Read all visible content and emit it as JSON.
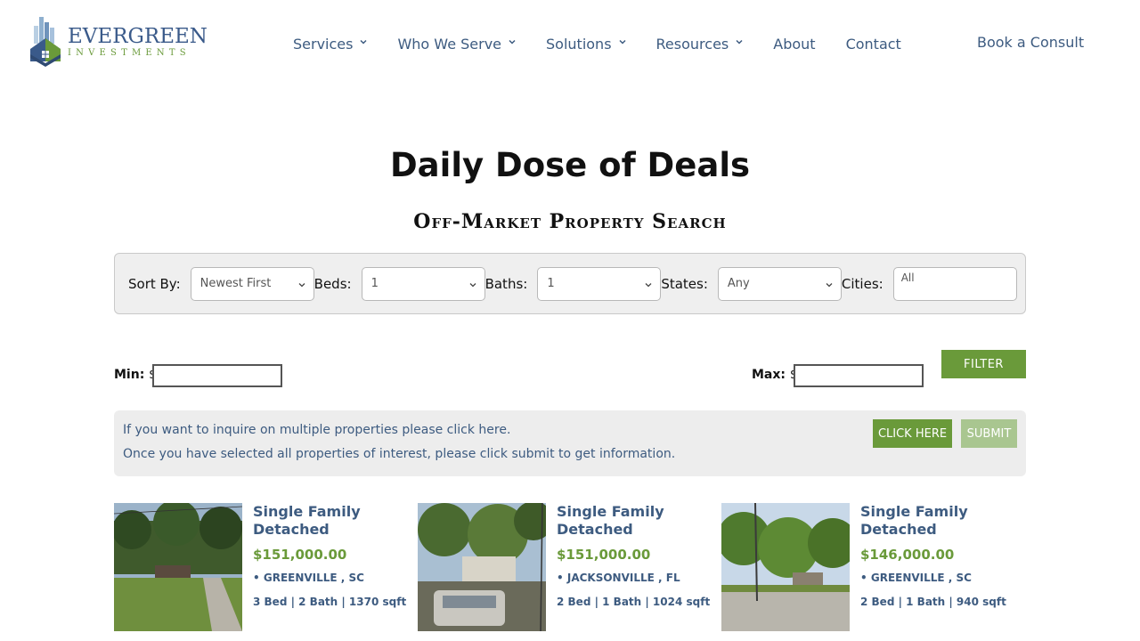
{
  "brand": {
    "name": "EVERGREEN",
    "tagline": "INVESTMENTS",
    "colors": {
      "primary_green": "#6a9a3a",
      "nav_blue": "#3d5b80",
      "light_green": "#a9c690"
    }
  },
  "nav": {
    "items": [
      {
        "label": "Services",
        "has_dropdown": true
      },
      {
        "label": "Who We Serve",
        "has_dropdown": true
      },
      {
        "label": "Solutions",
        "has_dropdown": true
      },
      {
        "label": "Resources",
        "has_dropdown": true
      },
      {
        "label": "About",
        "has_dropdown": false
      },
      {
        "label": "Contact",
        "has_dropdown": false
      }
    ],
    "cta": "Book a Consult"
  },
  "page": {
    "title": "Daily Dose of Deals",
    "subtitle": "Off-Market Property Search"
  },
  "filters": {
    "sort_label": "Sort By:",
    "sort_value": "Newest First",
    "beds_label": "Beds:",
    "beds_value": "1",
    "baths_label": "Baths:",
    "baths_value": "1",
    "states_label": "States:",
    "states_value": "Any",
    "cities_label": "Cities:",
    "cities_value": "All",
    "min_label": "Min:",
    "max_label": "Max:",
    "currency": "$",
    "filter_button": "FILTER"
  },
  "inquiry": {
    "line1": "If you want to inquire on multiple properties please click here.",
    "line2": "Once you have selected all properties of interest, please click submit to get information.",
    "click_button": "CLICK HERE",
    "submit_button": "SUBMIT"
  },
  "listings": [
    {
      "type": "Single Family Detached",
      "price": "$151,000.00",
      "location": "• GREENVILLE , SC",
      "specs": "3 Bed | 2 Bath | 1370 sqft"
    },
    {
      "type": "Single Family Detached",
      "price": "$151,000.00",
      "location": "• JACKSONVILLE , FL",
      "specs": "2 Bed | 1 Bath | 1024 sqft"
    },
    {
      "type": "Single Family Detached",
      "price": "$146,000.00",
      "location": "• GREENVILLE , SC",
      "specs": "2 Bed | 1 Bath | 940 sqft"
    }
  ]
}
